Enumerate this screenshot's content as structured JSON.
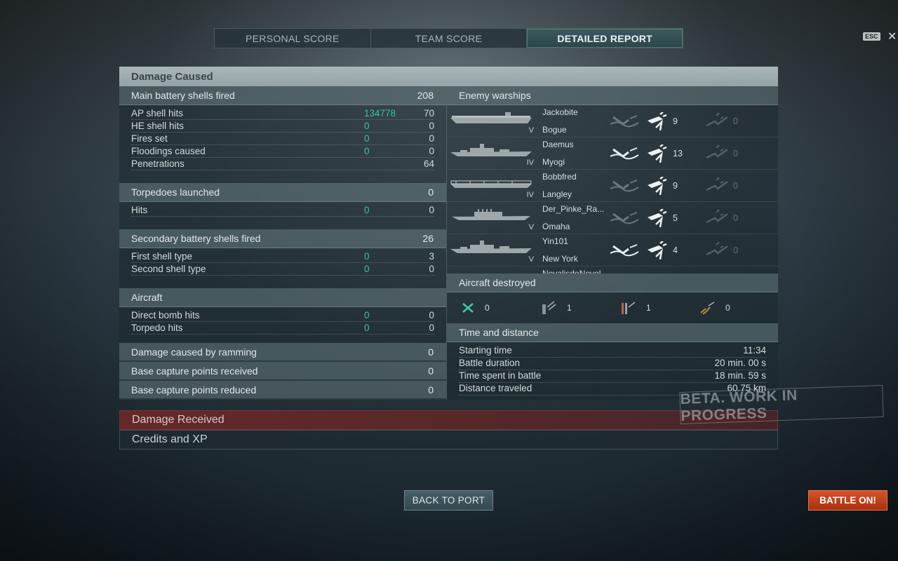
{
  "tabs": [
    {
      "label": "PERSONAL SCORE"
    },
    {
      "label": "TEAM SCORE"
    },
    {
      "label": "DETAILED REPORT"
    }
  ],
  "esc_label": "ESC",
  "close_glyph": "✕",
  "damage_caused": {
    "title": "Damage Caused",
    "main_battery": {
      "label": "Main battery shells fired",
      "value": "208",
      "rows": [
        {
          "label": "AP shell hits",
          "dmg": "134778",
          "value": "70"
        },
        {
          "label": "HE shell hits",
          "dmg": "0",
          "value": "0"
        },
        {
          "label": "Fires set",
          "dmg": "0",
          "value": "0"
        },
        {
          "label": "Floodings caused",
          "dmg": "0",
          "value": "0"
        },
        {
          "label": "Penetrations",
          "dmg": "",
          "value": "64"
        }
      ]
    },
    "torpedoes": {
      "label": "Torpedoes launched",
      "value": "0",
      "rows": [
        {
          "label": "Hits",
          "dmg": "0",
          "value": "0"
        }
      ]
    },
    "secondary": {
      "label": "Secondary battery shells fired",
      "value": "26",
      "rows": [
        {
          "label": "First shell type",
          "dmg": "0",
          "value": "3"
        },
        {
          "label": "Second shell type",
          "dmg": "0",
          "value": "0"
        }
      ]
    },
    "aircraft": {
      "label": "Aircraft",
      "value": "",
      "rows": [
        {
          "label": "Direct bomb hits",
          "dmg": "0",
          "value": "0"
        },
        {
          "label": "Torpedo hits",
          "dmg": "0",
          "value": "0"
        }
      ]
    },
    "ramming": {
      "label": "Damage caused by ramming",
      "value": "0"
    },
    "cap_received": {
      "label": "Base capture points received",
      "value": "0"
    },
    "cap_reduced": {
      "label": "Base capture points reduced",
      "value": "0"
    },
    "enemy_warships": {
      "label": "Enemy warships",
      "ships": [
        {
          "player": "Jackobite",
          "ship": "Bogue",
          "tier": "V",
          "type": "carrier",
          "sunk": false,
          "hits": "9",
          "fires": "0"
        },
        {
          "player": "Daemus",
          "ship": "Myogi",
          "tier": "IV",
          "type": "battleship",
          "sunk": true,
          "hits": "13",
          "fires": "0"
        },
        {
          "player": "Bobbfred",
          "ship": "Langley",
          "tier": "IV",
          "type": "carrier2",
          "sunk": false,
          "hits": "9",
          "fires": "0"
        },
        {
          "player": "Der_Pinke_Ra...",
          "ship": "Omaha",
          "tier": "V",
          "type": "cruiser",
          "sunk": false,
          "hits": "5",
          "fires": "0"
        },
        {
          "player": "Yin101",
          "ship": "New York",
          "tier": "V",
          "type": "battleship",
          "sunk": true,
          "hits": "4",
          "fires": "0"
        },
        {
          "player": "NovalisdeNovel",
          "ship": "",
          "tier": "",
          "type": "cruiser",
          "sunk": false,
          "hits": "",
          "fires": ""
        }
      ]
    },
    "aircraft_destroyed": {
      "label": "Aircraft destroyed",
      "items": [
        {
          "icon": "fighter-icon",
          "value": "0"
        },
        {
          "icon": "dive-bomber-icon",
          "value": "1"
        },
        {
          "icon": "torpedo-bomber-icon",
          "value": "1"
        },
        {
          "icon": "spotter-plane-icon",
          "value": "0"
        }
      ]
    },
    "time_distance": {
      "label": "Time and distance",
      "rows": [
        {
          "label": "Starting time",
          "value": "11:34"
        },
        {
          "label": "Battle duration",
          "value": "20 min. 00 s"
        },
        {
          "label": "Time spent in battle",
          "value": "18 min. 59 s"
        },
        {
          "label": "Distance traveled",
          "value": "60.75 km"
        }
      ]
    }
  },
  "damage_received_label": "Damage Received",
  "credits_xp_label": "Credits and XP",
  "beta_watermark": "BETA. WORK IN PROGRESS",
  "back_button": "BACK TO PORT",
  "battle_button": "BATTLE ON!",
  "colors": {
    "accent_green": "#35c2a8",
    "battle_orange": "#c8431c",
    "header_gray": "#a3b0b2"
  }
}
